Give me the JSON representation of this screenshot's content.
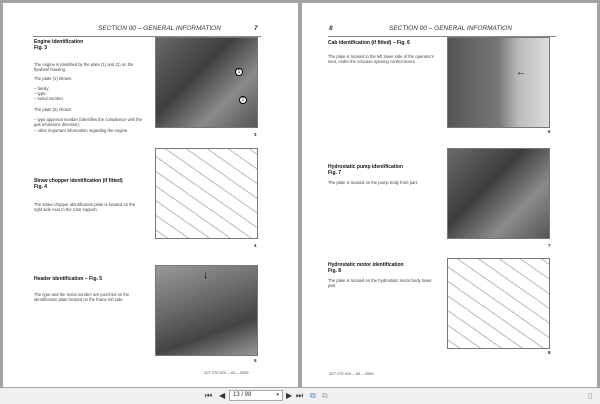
{
  "viewer": {
    "page_input": "13 / 98",
    "first": "⏮",
    "prev": "◀",
    "next": "▶",
    "last": "⏭"
  },
  "left": {
    "header": "SECTION 00 – GENERAL INFORMATION",
    "page_no": "7",
    "s1": {
      "title1": "Engine identification",
      "title2": "Fig. 3",
      "p1": "The engine is identified by the plate (1) and (2) on the flywheel housing.",
      "p2": "The plate (1) shows:",
      "l1": "–   family;",
      "l2": "–   type;",
      "l3": "–   serial number.",
      "p3": "The plate (2) shows:",
      "l4": "–   type approval number (identifies the compliance with the gas emissions directive);",
      "l5": "–   other important information regarding the engine.",
      "fig": "3",
      "c1": "1",
      "c2": "2"
    },
    "s2": {
      "title1": "Straw chopper identification (if fitted)",
      "title2": "Fig. 4",
      "p1": "The straw chopper identification plate is located on the right side next to the rotor support.",
      "fig": "4"
    },
    "s3": {
      "title": "Header identification –  Fig. 5",
      "p1": "The type and the serial number are punched on the identification plate located on the frame left side.",
      "fig": "5"
    },
    "footer": "327 270 010 – 03 – 2009"
  },
  "right": {
    "header": "SECTION 00 – GENERAL INFORMATION",
    "page_no": "8",
    "s1": {
      "title": "Cab identification (if fitted) – Fig. 6",
      "p1": "The plate is located in the left lower side of the operator's seat, under the concave opening control levers.",
      "fig": "6"
    },
    "s2": {
      "title1": "Hydrostatic pump identification",
      "title2": "Fig. 7",
      "p1": "The plate is located on the pump body front part.",
      "fig": "7"
    },
    "s3": {
      "title1": "Hydrostatic motor identification",
      "title2": "Fig. 8",
      "p1": "The plate is located on the hydrostatic motor body lower part.",
      "fig": "8"
    },
    "footer": "327 270 010 – 03 – 2009"
  }
}
